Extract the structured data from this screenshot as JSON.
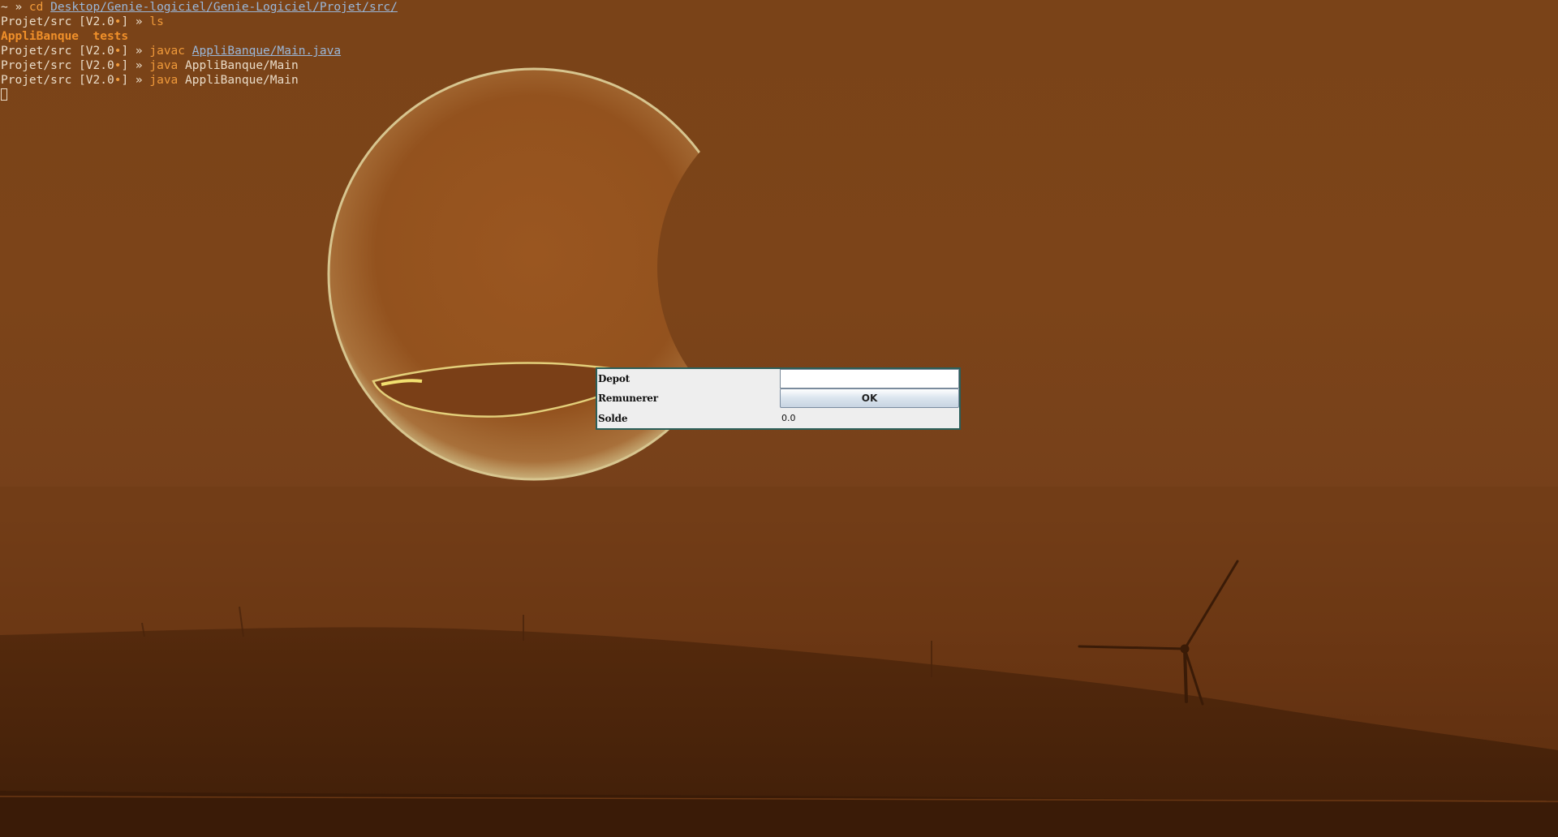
{
  "colors": {
    "terminal_text": "#eadcc8",
    "command": "#f09a3a",
    "path_link": "#9ab7d9",
    "directory_listing": "#f0902a",
    "window_border": "#2c5f5a",
    "window_background": "#eeeeee"
  },
  "terminal": {
    "lines": [
      {
        "prompt": "~ » ",
        "command": "cd",
        "args": "Desktop/Genie-logiciel/Genie-Logiciel/Projet/src/"
      },
      {
        "prompt_dir": "Projet/src",
        "prompt_branch": "[V2.0",
        "prompt_dirty": "•",
        "prompt_end": "] » ",
        "command": "ls"
      },
      {
        "output": "AppliBanque  tests"
      },
      {
        "prompt_dir": "Projet/src",
        "prompt_branch": "[V2.0",
        "prompt_dirty": "•",
        "prompt_end": "] » ",
        "command": "javac",
        "args": "AppliBanque/Main.java"
      },
      {
        "prompt_dir": "Projet/src",
        "prompt_branch": "[V2.0",
        "prompt_dirty": "•",
        "prompt_end": "] » ",
        "command": "java",
        "args": "AppliBanque/Main"
      },
      {
        "prompt_dir": "Projet/src",
        "prompt_branch": "[V2.0",
        "prompt_dirty": "•",
        "prompt_end": "] » ",
        "command": "java",
        "args": "AppliBanque/Main"
      }
    ]
  },
  "app_window": {
    "depot_label": "Depot",
    "depot_value": "",
    "remunerer_label": "Remunerer",
    "ok_label": "OK",
    "solde_label": "Solde",
    "solde_value": "0.0"
  },
  "wallpaper": {
    "subject": "partially eclipsed sun over hills with wind turbines"
  }
}
